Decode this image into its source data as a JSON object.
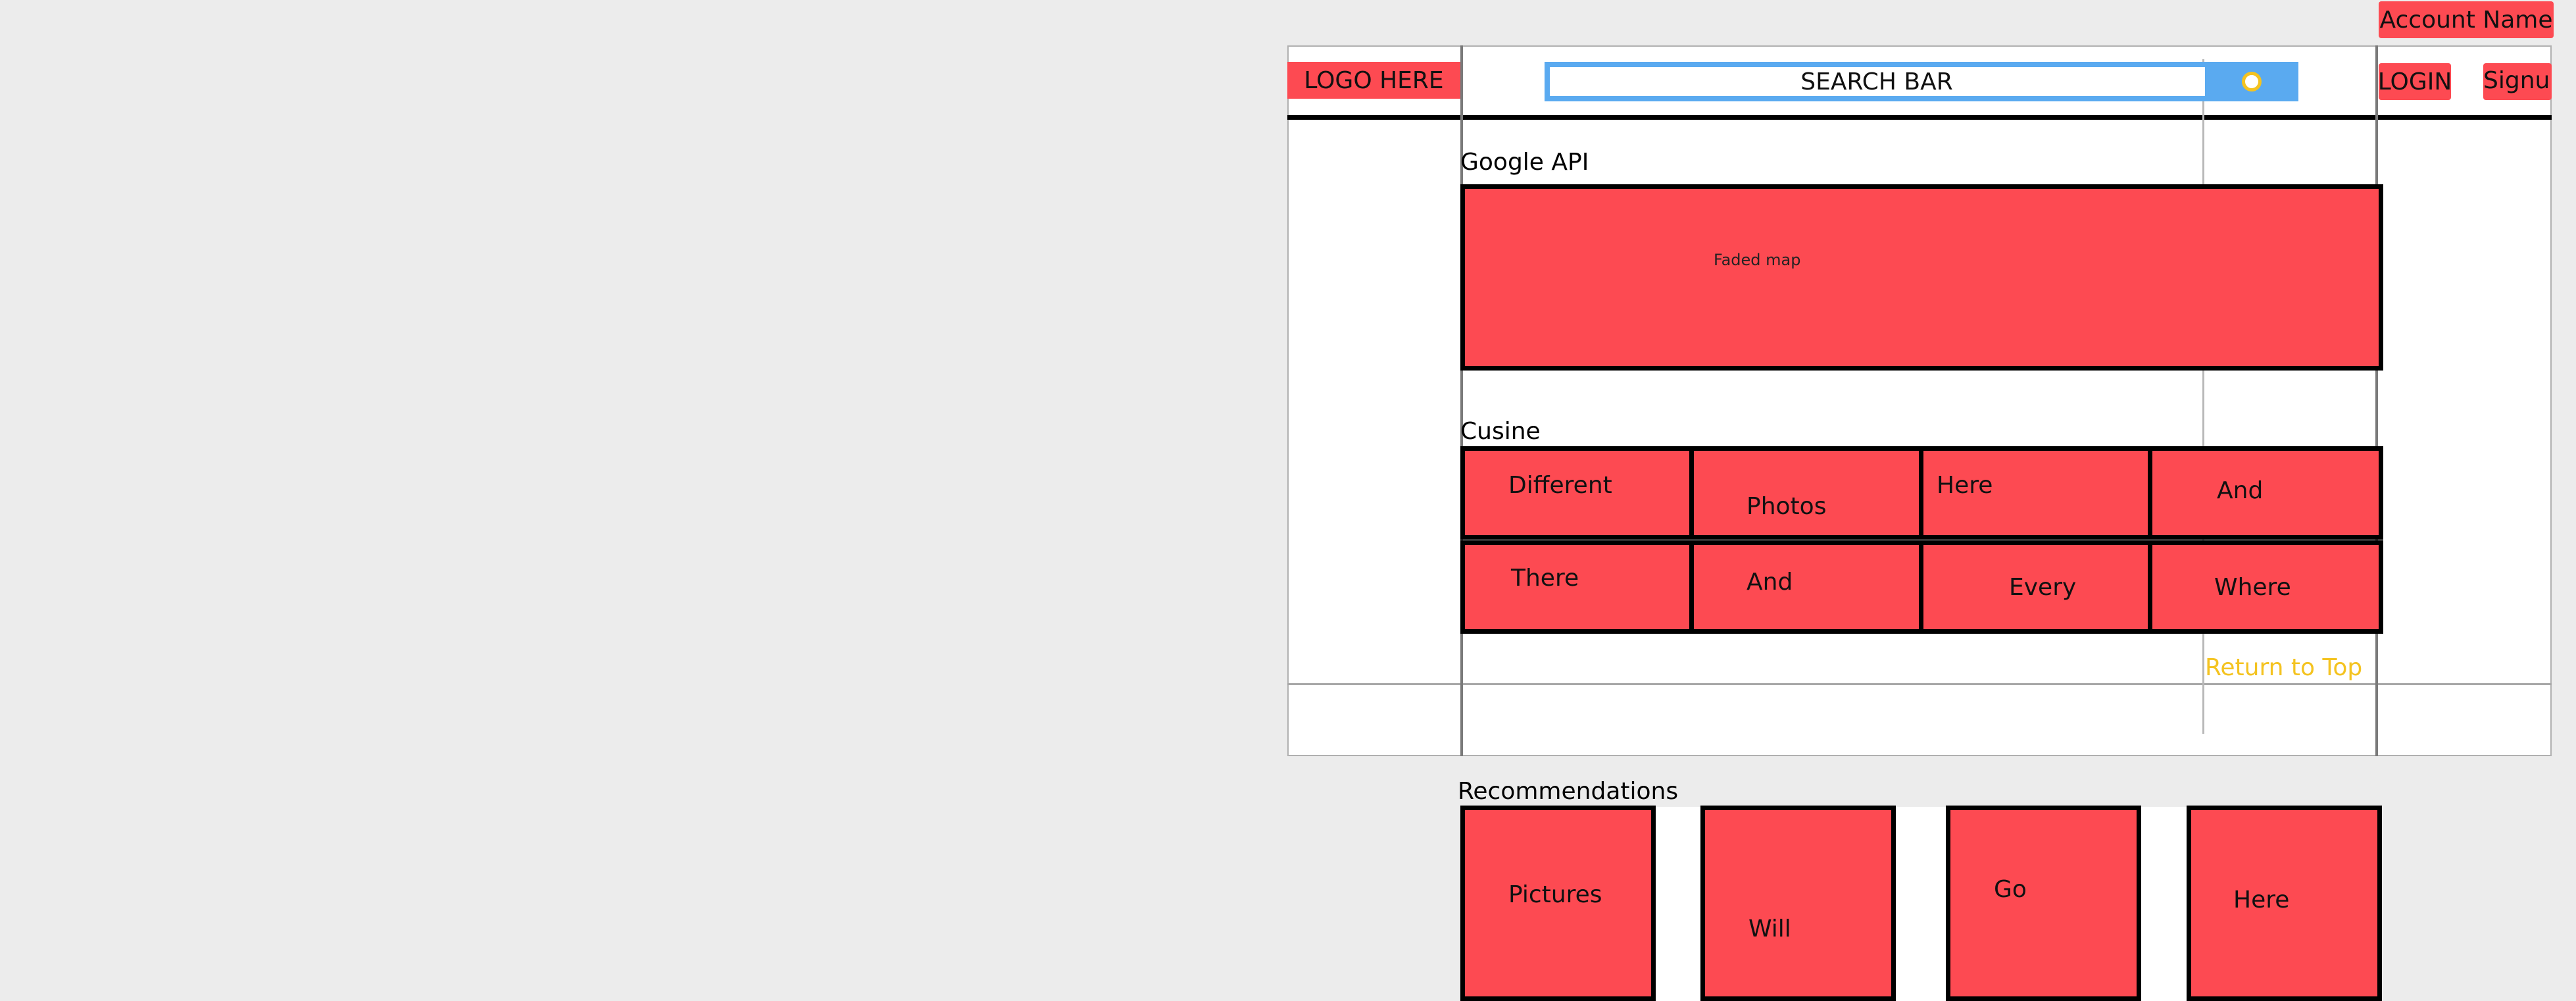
{
  "header": {
    "account_name": "Account Name",
    "logo_text": "LOGO HERE",
    "search_placeholder": "SEARCH BAR",
    "search_button_icon": "search-circle-icon",
    "login_label": "LOGIN",
    "signup_label": "Signup"
  },
  "map_section": {
    "heading": "Google API",
    "map_text": "Faded map"
  },
  "cuisine_section": {
    "heading": "Cusine",
    "tiles": [
      "Different",
      "Photos",
      "Here",
      "And",
      "There",
      "And",
      "Every",
      "Where"
    ]
  },
  "footer": {
    "return_to_top": "Return to Top"
  },
  "recommendations_section": {
    "heading": "Recommendations",
    "cards": [
      "Pictures",
      "Will",
      "Go",
      "Here"
    ]
  },
  "colors": {
    "background": "#ececec",
    "placeholder_red": "#fd4a52",
    "search_blue": "#5aaaf0",
    "link_yellow": "#f4c320",
    "border": "#000000"
  }
}
